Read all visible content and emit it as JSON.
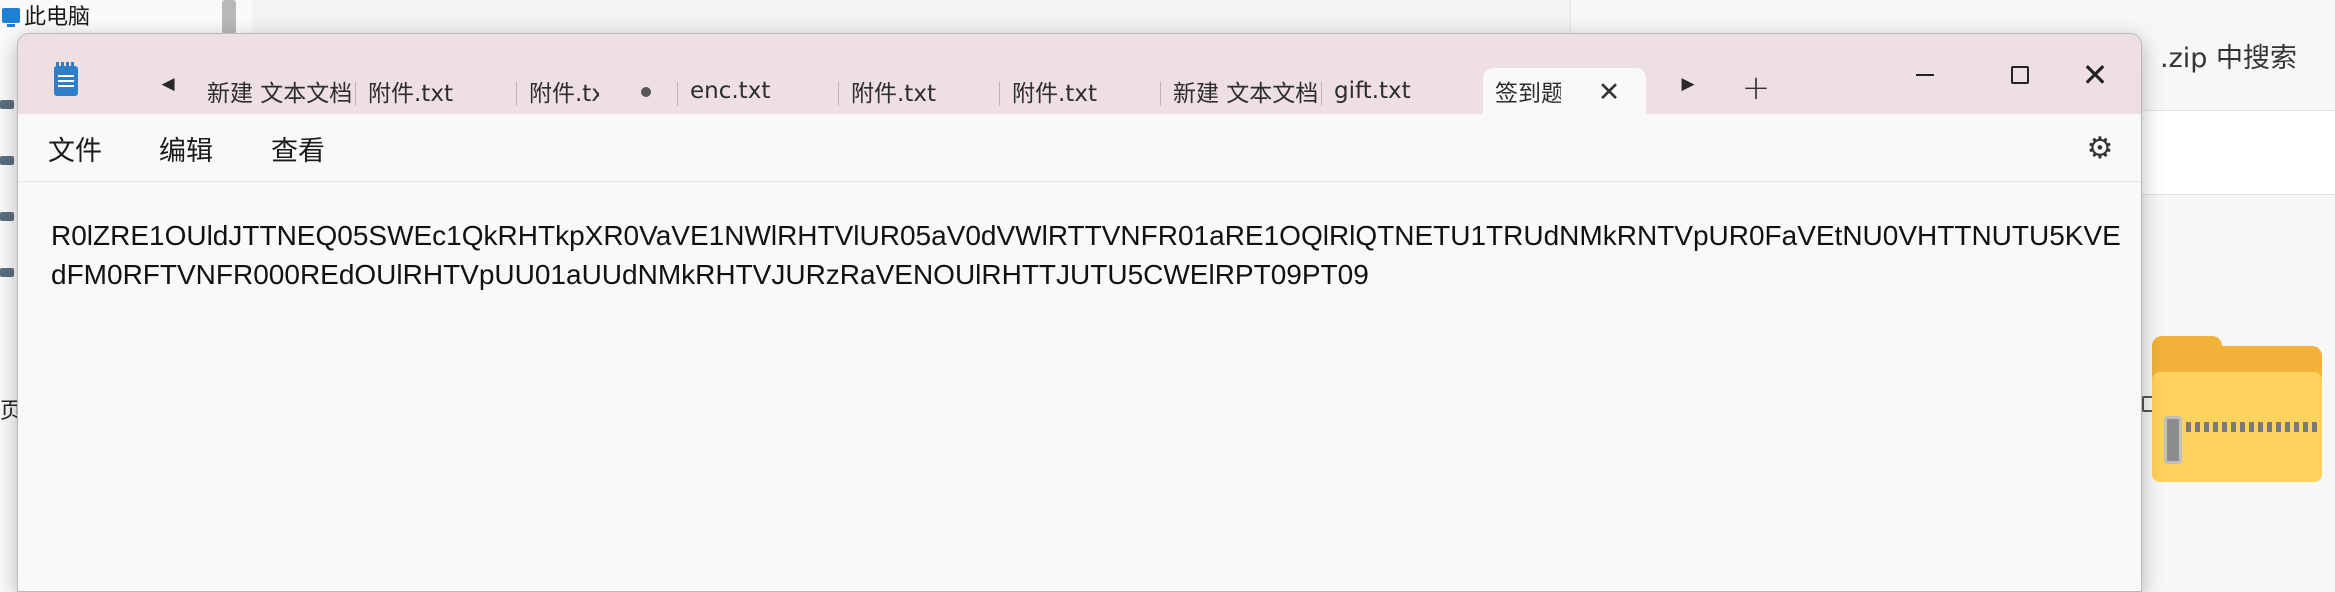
{
  "background": {
    "left_panel": {
      "pc_label": "此电脑",
      "cut_char": "页"
    },
    "right_panel": {
      "search_text": ".zip 中搜索"
    }
  },
  "notepad": {
    "tab_prev": "◀",
    "tab_next": "▶",
    "new_tab": "+",
    "tabs": [
      {
        "label": "新建 文本文档"
      },
      {
        "label": "附件.txt"
      },
      {
        "label": "附件.txt"
      },
      {
        "label": "enc.txt"
      },
      {
        "label": "附件.txt"
      },
      {
        "label": "附件.txt"
      },
      {
        "label": "新建 文本文档"
      },
      {
        "label": "gift.txt"
      },
      {
        "label": "签到题"
      }
    ],
    "tab_close_glyph": "✕",
    "window_controls": {
      "close_glyph": "✕"
    },
    "menu": {
      "file": "文件",
      "edit": "编辑",
      "view": "查看"
    },
    "settings_glyph": "⚙",
    "content": "R0lZRE1OUldJTTNEQ05SWEc1QkRHTkpXR0VaVE1NWlRHTVlUR05aV0dVWlRTTVNFR01aRE1OQlRlQTNETU1TRUdNMkRNTVpUR0FaVEtNU0VHTTNUTU5KVEdFM0RFTVNFR000REdOUlRHTVpUU01aUUdNMkRHTVJURzRaVENOUlRHTTJUTU5CWElRPT09PT09"
  }
}
